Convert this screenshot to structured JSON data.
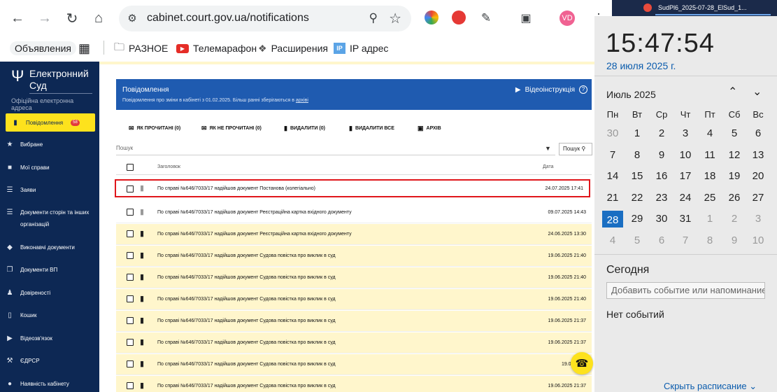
{
  "browser": {
    "url": "cabinet.court.gov.ua/notifications",
    "avatar": "VD",
    "bookmarks": [
      {
        "label": "Объявления"
      },
      {
        "label": "РАЗНОЕ"
      },
      {
        "label": "Телемарафон"
      },
      {
        "label": "Расширения"
      },
      {
        "label": "IP адрес"
      }
    ]
  },
  "site": {
    "logo_title": "Електронний Суд",
    "logo_subtitle": "Офіційна електронна адреса",
    "sidebar": [
      {
        "label": "Повідомлення",
        "badge": "58",
        "icon": "message-icon"
      },
      {
        "label": "Вибране",
        "icon": "star-icon"
      },
      {
        "label": "Мої справи",
        "icon": "folder-icon"
      },
      {
        "label": "Заяви",
        "icon": "list-icon"
      },
      {
        "label": "Документи сторін та інших організацій",
        "icon": "docs-icon"
      },
      {
        "label": "Виконавчі документи",
        "icon": "layers-icon"
      },
      {
        "label": "Документи ВП",
        "icon": "copy-icon"
      },
      {
        "label": "Довіреності",
        "icon": "people-icon"
      },
      {
        "label": "Кошик",
        "icon": "trash-icon"
      },
      {
        "label": "Відеозв'язок",
        "icon": "video-icon"
      },
      {
        "label": "ЄДРСР",
        "icon": "gavel-icon"
      },
      {
        "label": "Наявність кабінету",
        "icon": "person-icon"
      }
    ],
    "panel": {
      "title": "Повідомлення",
      "subtitle": "Повідомлення про зміни в кабінеті з 01.02.2025. Більш ранні зберігаються в",
      "subtitle_link": "архіві",
      "video_link": "Відеоінструкція",
      "help": "?"
    },
    "actions": [
      "ЯК ПРОЧИТАНІ (0)",
      "ЯК НЕ ПРОЧИТАНІ (0)",
      "ВИДАЛИТИ (0)",
      "ВИДАЛИТИ ВСЕ",
      "АРХІВ"
    ],
    "search": {
      "placeholder": "Пошук",
      "button": "Пошук"
    },
    "table_headers": {
      "title": "Заголовок",
      "date": "Дата"
    },
    "rows": [
      {
        "text": "По справі №646/7033/17 надійшов документ Постанова (колегіально)",
        "date": "24.07.2025 17:41",
        "unread": false,
        "selected": true
      },
      {
        "text": "По справі №646/7033/17 надійшов документ Реєстраційна картка вхідного документу",
        "date": "09.07.2025 14:43",
        "unread": false,
        "selected": false
      },
      {
        "text": "По справі №646/7033/17 надійшов документ Реєстраційна картка вхідного документу",
        "date": "24.06.2025 13:30",
        "unread": true,
        "selected": false
      },
      {
        "text": "По справі №646/7033/17 надійшов документ Судова повістка про виклик в суд",
        "date": "19.06.2025 21:40",
        "unread": true,
        "selected": false
      },
      {
        "text": "По справі №646/7033/17 надійшов документ Судова повістка про виклик в суд",
        "date": "19.06.2025 21:40",
        "unread": true,
        "selected": false
      },
      {
        "text": "По справі №646/7033/17 надійшов документ Судова повістка про виклик в суд",
        "date": "19.06.2025 21:40",
        "unread": true,
        "selected": false
      },
      {
        "text": "По справі №646/7033/17 надійшов документ Судова повістка про виклик в суд",
        "date": "19.06.2025 21:37",
        "unread": true,
        "selected": false
      },
      {
        "text": "По справі №646/7033/17 надійшов документ Судова повістка про виклик в суд",
        "date": "19.06.2025 21:37",
        "unread": true,
        "selected": false
      },
      {
        "text": "По справі №646/7033/17 надійшов документ Судова повістка про виклик в суд",
        "date": "19.06.2025",
        "unread": true,
        "selected": false
      },
      {
        "text": "По справі №646/7033/17 надійшов документ Судова повістка про виклик в суд",
        "date": "19.06.2025 21:37",
        "unread": true,
        "selected": false
      }
    ]
  },
  "taskbar": {
    "title": "SudPl6_2025-07-28_ElSud_1..."
  },
  "calendar": {
    "time": "15:47:54",
    "date": "28 июля 2025 г.",
    "month": "Июль 2025",
    "weekdays": [
      "Пн",
      "Вт",
      "Ср",
      "Чт",
      "Пт",
      "Сб",
      "Вс"
    ],
    "weeks": [
      [
        "30",
        "1",
        "2",
        "3",
        "4",
        "5",
        "6"
      ],
      [
        "7",
        "8",
        "9",
        "10",
        "11",
        "12",
        "13"
      ],
      [
        "14",
        "15",
        "16",
        "17",
        "18",
        "19",
        "20"
      ],
      [
        "21",
        "22",
        "23",
        "24",
        "25",
        "26",
        "27"
      ],
      [
        "28",
        "29",
        "30",
        "31",
        "1",
        "2",
        "3"
      ],
      [
        "4",
        "5",
        "6",
        "7",
        "8",
        "9",
        "10"
      ]
    ],
    "today_label": "Сегодня",
    "event_placeholder": "Добавить событие или напоминание",
    "no_events": "Нет событий",
    "schedule_link": "Скрыть расписание"
  }
}
